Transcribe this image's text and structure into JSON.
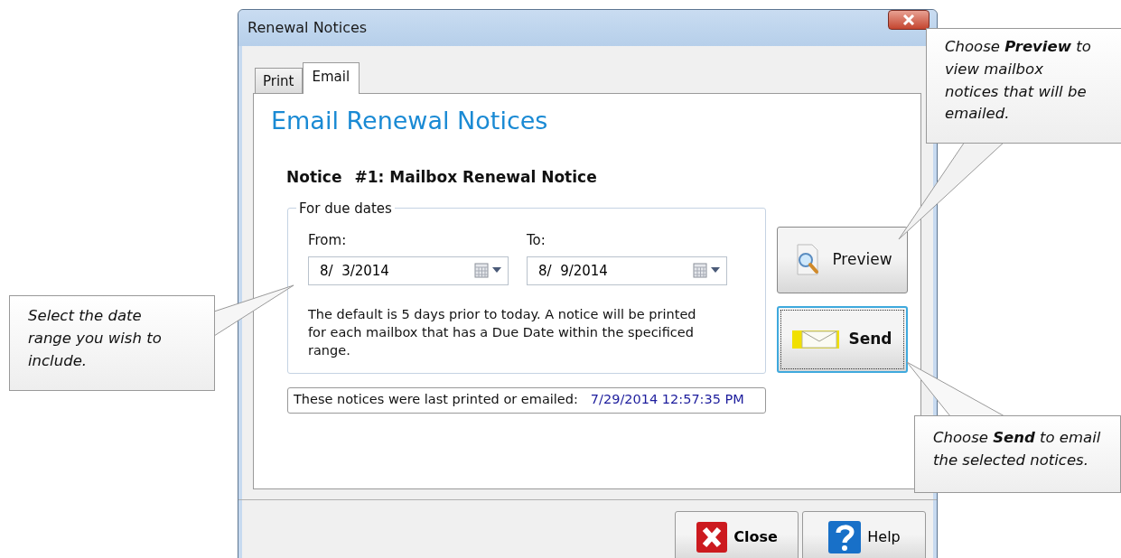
{
  "window": {
    "title": "Renewal Notices"
  },
  "tabs": [
    {
      "label": "Print",
      "selected": false
    },
    {
      "label": "Email",
      "selected": true
    }
  ],
  "heading": "Email Renewal Notices",
  "notice": {
    "label": "Notice",
    "title": "#1: Mailbox Renewal Notice"
  },
  "date_group": {
    "legend": "For due dates",
    "fields": [
      {
        "label": "From:",
        "value": "8/  3/2014"
      },
      {
        "label": "To:",
        "value": "8/  9/2014"
      }
    ],
    "description": "The default is 5 days prior to today. A notice will be printed for each mailbox that has a Due Date within the specificed range."
  },
  "last_sent": {
    "label": "These notices were last printed or emailed:",
    "value": "7/29/2014 12:57:35 PM"
  },
  "action_buttons": [
    {
      "label": "Preview",
      "kind": "preview",
      "focused": false
    },
    {
      "label": "Send",
      "kind": "send",
      "focused": true
    }
  ],
  "footer_buttons": [
    {
      "label": "Close",
      "kind": "close"
    },
    {
      "label": "Help",
      "kind": "help"
    }
  ],
  "callouts": [
    {
      "text": "Choose **Preview** to view mailbox notices that will be emailed."
    },
    {
      "text": "Select the date range you wish to include."
    },
    {
      "text": "Choose **Send** to email the selected notices."
    }
  ]
}
